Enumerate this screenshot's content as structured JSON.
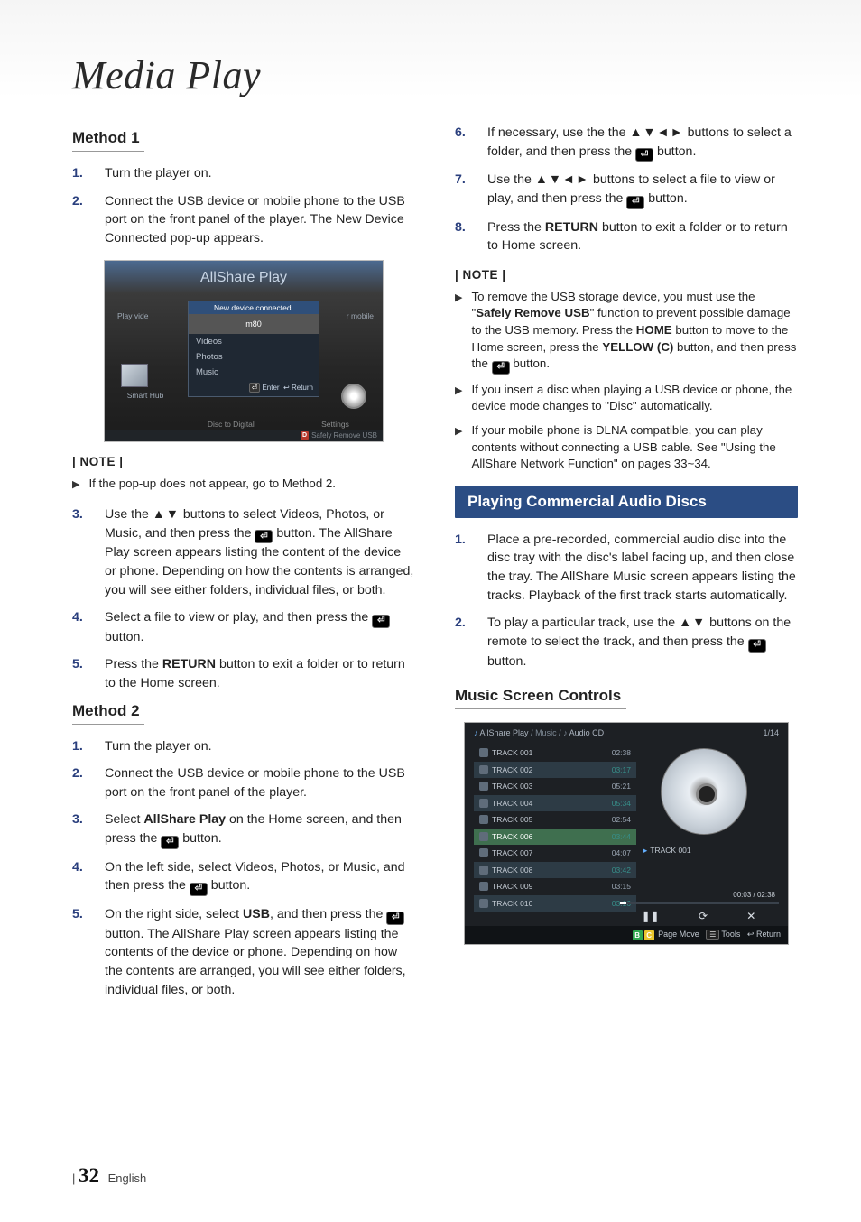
{
  "title": "Media Play",
  "footer": {
    "page": "32",
    "lang": "English"
  },
  "left": {
    "method1": {
      "heading": "Method 1",
      "steps": [
        "Turn the player on.",
        "Connect the USB device or mobile phone to the USB port on the front panel of the player. The New Device Connected pop-up appears."
      ],
      "note_label": "| NOTE |",
      "notes": [
        "If the pop-up does not appear, go to Method 2."
      ],
      "steps_cont": {
        "3": "Use the ▲▼ buttons to select Videos, Photos, or Music, and then press the _E_ button. The AllShare Play screen appears listing the content of the device or phone. Depending on how the contents is arranged, you will see either folders, individual files, or both.",
        "4": "Select a file to view or play, and then press the _E_ button.",
        "5_a": "Press the ",
        "5_b": "RETURN",
        "5_c": " button to exit a folder or to return to the Home screen."
      }
    },
    "method2": {
      "heading": "Method 2",
      "steps": {
        "1": "Turn the player on.",
        "2": "Connect the USB device or mobile phone to the USB port on the front panel of the player.",
        "3_a": "Select ",
        "3_b": "AllShare Play",
        "3_c": " on the Home screen, and then press the _E_ button.",
        "4": "On the left side, select Videos, Photos, or Music, and then press the _E_ button.",
        "5_a": "On the right side, select ",
        "5_b": "USB",
        "5_c": ", and then press the _E_ button. The AllShare Play screen appears listing the contents of the device or phone. Depending on how the contents are arranged, you will see either folders, individual files, or both."
      }
    },
    "allshare": {
      "title": "AllShare Play",
      "popup_header": "New device connected.",
      "popup_device": "m80",
      "items": [
        "Videos",
        "Photos",
        "Music"
      ],
      "enter": "Enter",
      "return": "Return",
      "left_label": "Play vide",
      "right_label": "r mobile",
      "smart_hub": "Smart Hub",
      "disc_to_digital": "Disc to Digital",
      "settings": "Settings",
      "safely_remove": "Safely Remove USB",
      "d_key": "D"
    }
  },
  "right": {
    "steps_cont": {
      "6": "If necessary, use the the ▲▼◄► buttons to select a folder, and then press the _E_ button.",
      "7": "Use the ▲▼◄► buttons to select a file to view or play, and then press the _E_ button.",
      "8_a": "Press the ",
      "8_b": "RETURN",
      "8_c": " button to exit a folder or to return to Home screen."
    },
    "note_label": "| NOTE |",
    "notes": {
      "n1_a": "To remove the USB storage device, you must use the \"",
      "n1_b": "Safely Remove USB",
      "n1_c": "\" function to prevent possible damage to the USB memory. Press the ",
      "n1_d": "HOME",
      "n1_e": " button to move to the Home screen, press the ",
      "n1_f": "YELLOW (C)",
      "n1_g": " button, and then press the _E_ button.",
      "n2": "If you insert a disc when playing a USB device or phone, the device mode changes to \"Disc\" automatically.",
      "n3": "If your mobile phone is DLNA compatible, you can play contents without connecting a USB cable. See \"Using the AllShare Network Function\" on pages 33~34."
    },
    "section_heading": "Playing Commercial Audio Discs",
    "section_steps": {
      "1": "Place a pre-recorded, commercial audio disc into the disc tray with the disc's label facing up, and then close the tray. The AllShare Music screen appears listing the tracks. Playback of the first track starts automatically.",
      "2": "To play a particular track, use the ▲▼ buttons on the remote to select the track, and then press the _E_ button."
    },
    "music_heading": "Music Screen Controls",
    "music": {
      "crumb_a": "AllShare Play",
      "crumb_b": "/ Music /",
      "crumb_c": "Audio CD",
      "counter": "1/14",
      "tracks": [
        {
          "name": "TRACK 001",
          "time": "02:38"
        },
        {
          "name": "TRACK 002",
          "time": "03:17"
        },
        {
          "name": "TRACK 003",
          "time": "05:21"
        },
        {
          "name": "TRACK 004",
          "time": "05:34"
        },
        {
          "name": "TRACK 005",
          "time": "02:54"
        },
        {
          "name": "TRACK 006",
          "time": "03:44"
        },
        {
          "name": "TRACK 007",
          "time": "04:07"
        },
        {
          "name": "TRACK 008",
          "time": "03:42"
        },
        {
          "name": "TRACK 009",
          "time": "03:15"
        },
        {
          "name": "TRACK 010",
          "time": "03:16"
        }
      ],
      "now_playing": "TRACK 001",
      "time": "00:03 / 02:38",
      "bottom": {
        "b": "B",
        "c": "C",
        "page_move": "Page Move",
        "tools": "Tools",
        "return": "Return"
      }
    }
  }
}
